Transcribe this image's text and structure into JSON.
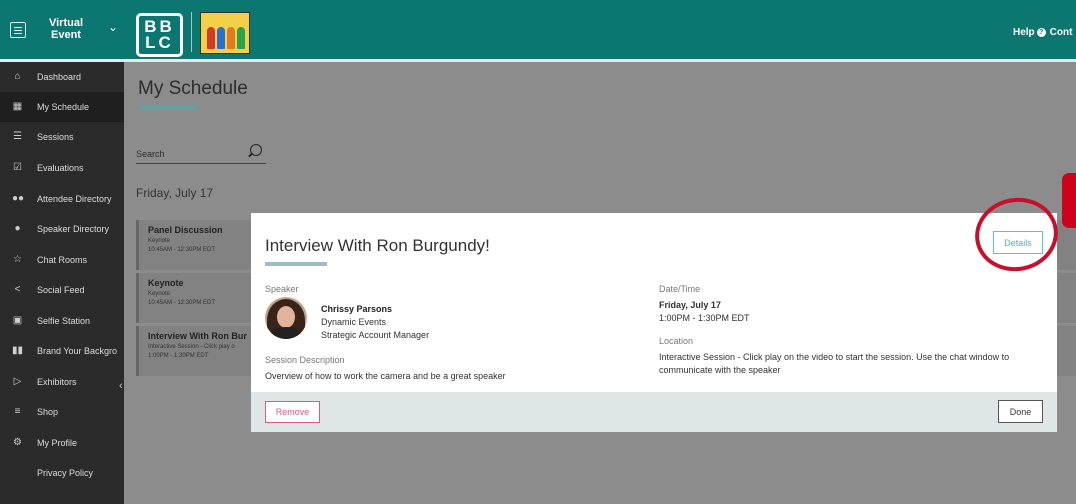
{
  "header": {
    "event_name_line1": "Virtual",
    "event_name_line2": "Event",
    "logo_line1": "BB",
    "logo_line2": "LC",
    "help_label": "Help",
    "contact_label": "Cont"
  },
  "sidebar": {
    "items": [
      {
        "label": "Dashboard",
        "icon": "home-icon"
      },
      {
        "label": "My Schedule",
        "icon": "calendar-icon"
      },
      {
        "label": "Sessions",
        "icon": "list-icon"
      },
      {
        "label": "Evaluations",
        "icon": "checkbox-icon"
      },
      {
        "label": "Attendee Directory",
        "icon": "people-icon"
      },
      {
        "label": "Speaker Directory",
        "icon": "microphone-icon"
      },
      {
        "label": "Chat Rooms",
        "icon": "star-icon"
      },
      {
        "label": "Social Feed",
        "icon": "share-icon"
      },
      {
        "label": "Selfie Station",
        "icon": "camera-icon"
      },
      {
        "label": "Brand Your Backgro",
        "icon": "film-icon"
      },
      {
        "label": "Exhibitors",
        "icon": "megaphone-icon"
      },
      {
        "label": "Shop",
        "icon": "cart-icon"
      },
      {
        "label": "My Profile",
        "icon": "gear-icon"
      },
      {
        "label": "Privacy Policy",
        "icon": ""
      }
    ],
    "active_index": 1
  },
  "main": {
    "page_title": "My Schedule",
    "search_placeholder": "Search",
    "day_heading": "Friday, July 17",
    "sessions": [
      {
        "title": "Panel Discussion",
        "type": "Keynote",
        "time": "10:45AM - 12:30PM EDT"
      },
      {
        "title": "Keynote",
        "type": "Keynote",
        "time": "10:45AM - 12:30PM EDT"
      },
      {
        "title": "Interview With Ron Bur",
        "type": "Interactive Session - Click play o",
        "time": "1:00PM - 1:30PM EDT"
      }
    ]
  },
  "modal": {
    "title": "Interview With Ron Burgundy!",
    "details_label": "Details",
    "speaker_label": "Speaker",
    "speaker_name": "Chrissy Parsons",
    "speaker_org": "Dynamic Events",
    "speaker_role": "Strategic Account Manager",
    "description_label": "Session Description",
    "description": "Overview of how to work the camera and be a great speaker",
    "datetime_label": "Date/Time",
    "date": "Friday, July 17",
    "time": "1:00PM - 1:30PM EDT",
    "location_label": "Location",
    "location": "Interactive Session - Click play on the video to start the session. Use the chat window to communicate with the speaker",
    "remove_label": "Remove",
    "done_label": "Done"
  },
  "colors": {
    "header_bg": "#0b7770",
    "sidebar_bg": "#2b2b2b",
    "details_accent": "#56c3d9",
    "remove_accent": "#e05a7c",
    "annotation": "#c8102e"
  }
}
